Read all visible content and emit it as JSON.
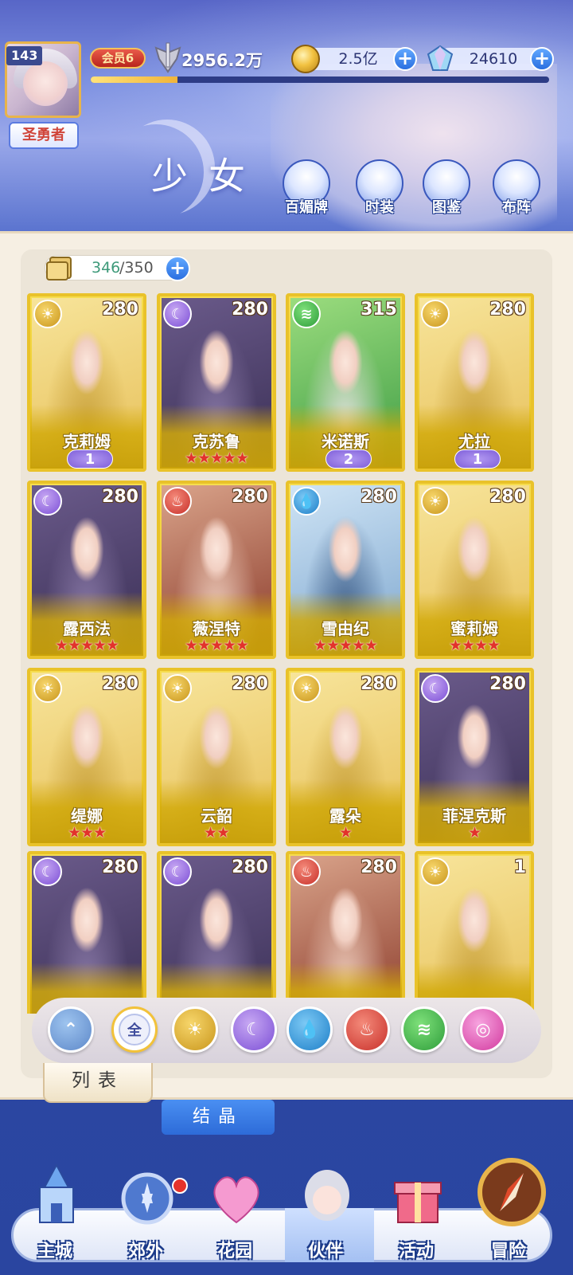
{
  "player": {
    "level": "143",
    "title": "圣勇者",
    "vip": "会员6",
    "power": "2956.2万",
    "exp_progress": 0.19
  },
  "currency": {
    "gold": "2.5亿",
    "gems": "24610"
  },
  "page_title": "少女",
  "top_buttons": [
    "百媚牌",
    "时装",
    "图鉴",
    "布阵"
  ],
  "capacity": {
    "current": "346",
    "max": "/350"
  },
  "characters": [
    {
      "name": "克莉姆",
      "level": "280",
      "element": "sun",
      "awaken": "1"
    },
    {
      "name": "克苏鲁",
      "level": "280",
      "element": "moon",
      "stars": "★★★★★"
    },
    {
      "name": "米诺斯",
      "level": "315",
      "element": "wind",
      "awaken": "2"
    },
    {
      "name": "尤拉",
      "level": "280",
      "element": "sun",
      "awaken": "1"
    },
    {
      "name": "露西法",
      "level": "280",
      "element": "moon",
      "stars": "★★★★★"
    },
    {
      "name": "薇涅特",
      "level": "280",
      "element": "fire",
      "stars": "★★★★★"
    },
    {
      "name": "雪由纪",
      "level": "280",
      "element": "water",
      "stars": "★★★★★"
    },
    {
      "name": "蜜莉姆",
      "level": "280",
      "element": "sun",
      "stars": "★★★★"
    },
    {
      "name": "缇娜",
      "level": "280",
      "element": "sun",
      "stars": "★★★"
    },
    {
      "name": "云韶",
      "level": "280",
      "element": "sun",
      "stars": "★★"
    },
    {
      "name": "露朵",
      "level": "280",
      "element": "sun",
      "stars": "★"
    },
    {
      "name": "菲涅克斯",
      "level": "280",
      "element": "moon",
      "stars": "★"
    },
    {
      "name": "",
      "level": "280",
      "element": "moon"
    },
    {
      "name": "",
      "level": "280",
      "element": "moon"
    },
    {
      "name": "",
      "level": "280",
      "element": "fire"
    },
    {
      "name": "",
      "level": "1",
      "element": "sun"
    }
  ],
  "filters": {
    "all_label": "全",
    "items": [
      "up",
      "all",
      "sun",
      "moon",
      "water",
      "fire",
      "wind",
      "light"
    ]
  },
  "tabs": {
    "list": "列表",
    "crystal": "结晶"
  },
  "nav": [
    "主城",
    "郊外",
    "花园",
    "伙伴",
    "活动",
    "冒险"
  ],
  "icons": {
    "sun": "☀",
    "moon": "☾",
    "wind": "≋",
    "water": "💧",
    "fire": "♨",
    "light": "◎",
    "up": "⌃"
  }
}
